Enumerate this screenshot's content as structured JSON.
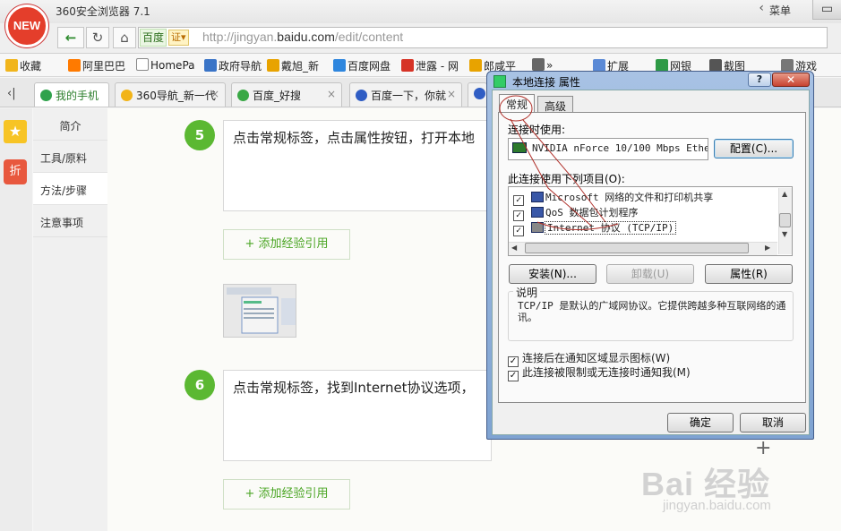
{
  "browser": {
    "app_title": "360安全浏览器 7.1",
    "logo_text": "NEW",
    "menu_label": "菜单",
    "menu_chevron": "‹",
    "window_button": "▭",
    "nav_icons": [
      "back-arrow-icon",
      "reload-icon",
      "home-icon"
    ],
    "address": {
      "site_label": "百度",
      "cert_badge": "证▾",
      "url_prefix": "http://jingyan.",
      "url_host": "baidu.com",
      "url_path": "/edit/content"
    }
  },
  "bookmarks": [
    {
      "label": "收藏",
      "icon": "star-icon",
      "color": "#f1b51c"
    },
    {
      "label": "阿里巴巴",
      "icon": "alibaba-icon",
      "color": "#ff7a00"
    },
    {
      "label": "HomePa",
      "icon": "page-icon",
      "color": "#ffffff"
    },
    {
      "label": "政府导航",
      "icon": "search-icon",
      "color": "#3a74c7"
    },
    {
      "label": "戴旭_新",
      "icon": "grid-icon",
      "color": "#e8a300"
    },
    {
      "label": "百度网盘",
      "icon": "cloud-icon",
      "color": "#2e86de"
    },
    {
      "label": "泄露 - 网",
      "icon": "ring-icon",
      "color": "#d63326"
    },
    {
      "label": "郎咸平",
      "icon": "grid-icon",
      "color": "#e8a300"
    },
    {
      "label": "»",
      "icon": "more-icon",
      "color": "#666666"
    },
    {
      "label": "扩展",
      "icon": "extensions-icon",
      "color": "#5b8ad6"
    },
    {
      "label": "网银",
      "icon": "shield-icon",
      "color": "#2e9a46"
    },
    {
      "label": "截图",
      "icon": "scissors-icon",
      "color": "#555555"
    },
    {
      "label": "游戏",
      "icon": "gamepad-icon",
      "color": "#777777"
    }
  ],
  "tabs": [
    {
      "label": "我的手机",
      "active": true,
      "color": "#2fa24c"
    },
    {
      "label": "360导航_新一代",
      "active": false,
      "color": "#f2b418"
    },
    {
      "label": "百度_好搜",
      "active": false,
      "color": "#39a845"
    },
    {
      "label": "百度一下，你就",
      "active": false,
      "color": "#2f5dc4"
    },
    {
      "label": "",
      "active": false,
      "color": "#2f5dc4"
    }
  ],
  "tab_close": "×",
  "tabs_collapse": "‹|",
  "side_icons": {
    "favorite": "★",
    "deal": "折"
  },
  "sidenav": [
    "简介",
    "工具/原料",
    "方法/步骤",
    "注意事项"
  ],
  "steps": [
    {
      "number": "5",
      "text": "点击常规标签，点击属性按钮，打开本地"
    },
    {
      "number": "6",
      "text": "点击常规标签，找到Internet协议选项，"
    }
  ],
  "add_ref_label": "+ 添加经验引用",
  "add_icon": "+",
  "watermark": {
    "brand": "Bai 经验",
    "url": "jingyan.baidu.com"
  },
  "dialog": {
    "title": "本地连接 属性",
    "help_label": "?",
    "close_label": "✕",
    "tabs": [
      "常规",
      "高级"
    ],
    "connect_using_label": "连接时使用:",
    "adapter_name": "NVIDIA nForce 10/100 Mbps Ethe",
    "configure_label": "配置(C)...",
    "items_label": "此连接使用下列项目(O):",
    "items": [
      {
        "label": "Microsoft 网络的文件和打印机共享",
        "checked": true
      },
      {
        "label": "QoS 数据包计划程序",
        "checked": true
      },
      {
        "label": "Internet 协议 (TCP/IP)",
        "checked": true
      }
    ],
    "install_label": "安装(N)...",
    "uninstall_label": "卸载(U)",
    "properties_label": "属性(R)",
    "description_label": "说明",
    "description_text": "TCP/IP 是默认的广域网协议。它提供跨越多种互联网络的通讯。",
    "checkbox_notify_icon": "连接后在通知区域显示图标(W)",
    "checkbox_notify_limited": "此连接被限制或无连接时通知我(M)",
    "ok_label": "确定",
    "cancel_label": "取消",
    "checkmark": "✓"
  }
}
